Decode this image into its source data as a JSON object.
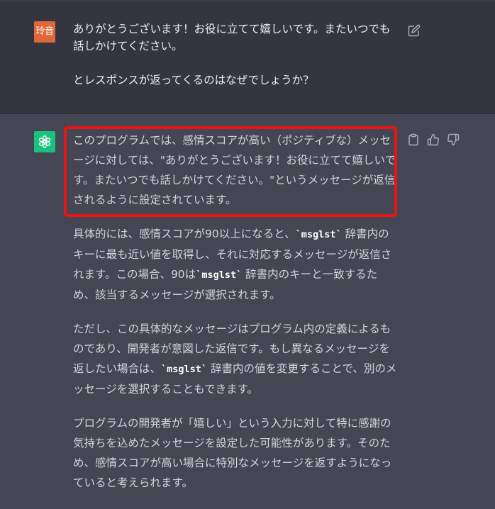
{
  "user_message": {
    "avatar_text": "玲音",
    "paragraph_1": "ありがとうございます！お役に立てて嬉しいです。またいつでも話しかけてください。",
    "paragraph_2": "とレスポンスが返ってくるのはなぜでしょうか？"
  },
  "assistant_message": {
    "paragraph_1": "このプログラムでは、感情スコアが高い（ポジティブな）メッセージに対しては、\"ありがとうございます！お役に立てて嬉しいです。またいつでも話しかけてください。\"というメッセージが返信されるように設定されています。",
    "paragraph_2": {
      "part_1": "具体的には、感情スコアが90以上になると、",
      "code_1": "`msglst`",
      "part_2": " 辞書内のキーに最も近い値を取得し、それに対応するメッセージが返信されます。この場合、90は",
      "code_2": "`msglst`",
      "part_3": " 辞書内のキーと一致するため、該当するメッセージが選択されます。"
    },
    "paragraph_3": {
      "part_1": "ただし、この具体的なメッセージはプログラム内の定義によるものであり、開発者が意図した返信です。もし異なるメッセージを返したい場合は、",
      "code_1": "`msglst`",
      "part_2": " 辞書内の値を変更することで、別のメッセージを選択することもできます。"
    },
    "paragraph_4": "プログラムの開発者が「嬉しい」という入力に対して特に感謝の気持ちを込めたメッセージを設定した可能性があります。そのため、感情スコアが高い場合に特別なメッセージを返すようになっていると考えられます。"
  },
  "icons": {
    "edit": "edit-icon",
    "copy": "clipboard-icon",
    "like": "thumbs-up-icon",
    "dislike": "thumbs-down-icon",
    "assistant_logo": "openai-logo-icon"
  },
  "colors": {
    "user_bg": "#343541",
    "assistant_bg": "#444654",
    "user_avatar": "#e0673a",
    "assistant_avatar": "#19c37d",
    "highlight": "#e81515"
  }
}
